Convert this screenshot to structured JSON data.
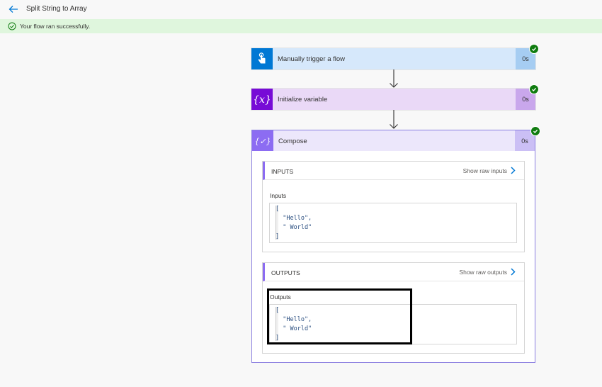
{
  "header": {
    "title": "Split String to Array"
  },
  "banner": {
    "message": "Your flow ran successfully."
  },
  "steps": [
    {
      "name": "Manually trigger a flow",
      "duration": "0s",
      "accent": "#0078d4",
      "bg": "#d6e8fb",
      "dur_bg": "#a6cdf2"
    },
    {
      "name": "Initialize variable",
      "duration": "0s",
      "accent": "#770bd6",
      "bg": "#ead9f7",
      "dur_bg": "#c9a7ec"
    }
  ],
  "compose": {
    "name": "Compose",
    "duration": "0s",
    "inputs": {
      "title": "INPUTS",
      "raw_link": "Show raw inputs",
      "label": "Inputs",
      "code": "[\n  \"Hello\",\n  \" World\"\n]"
    },
    "outputs": {
      "title": "OUTPUTS",
      "raw_link": "Show raw outputs",
      "label": "Outputs",
      "code": "[\n  \"Hello\",\n  \" World\"\n]"
    }
  },
  "colors": {
    "success": "#107c10",
    "banner_bg": "#dff6dd",
    "compose_accent": "#8c6cf2"
  }
}
